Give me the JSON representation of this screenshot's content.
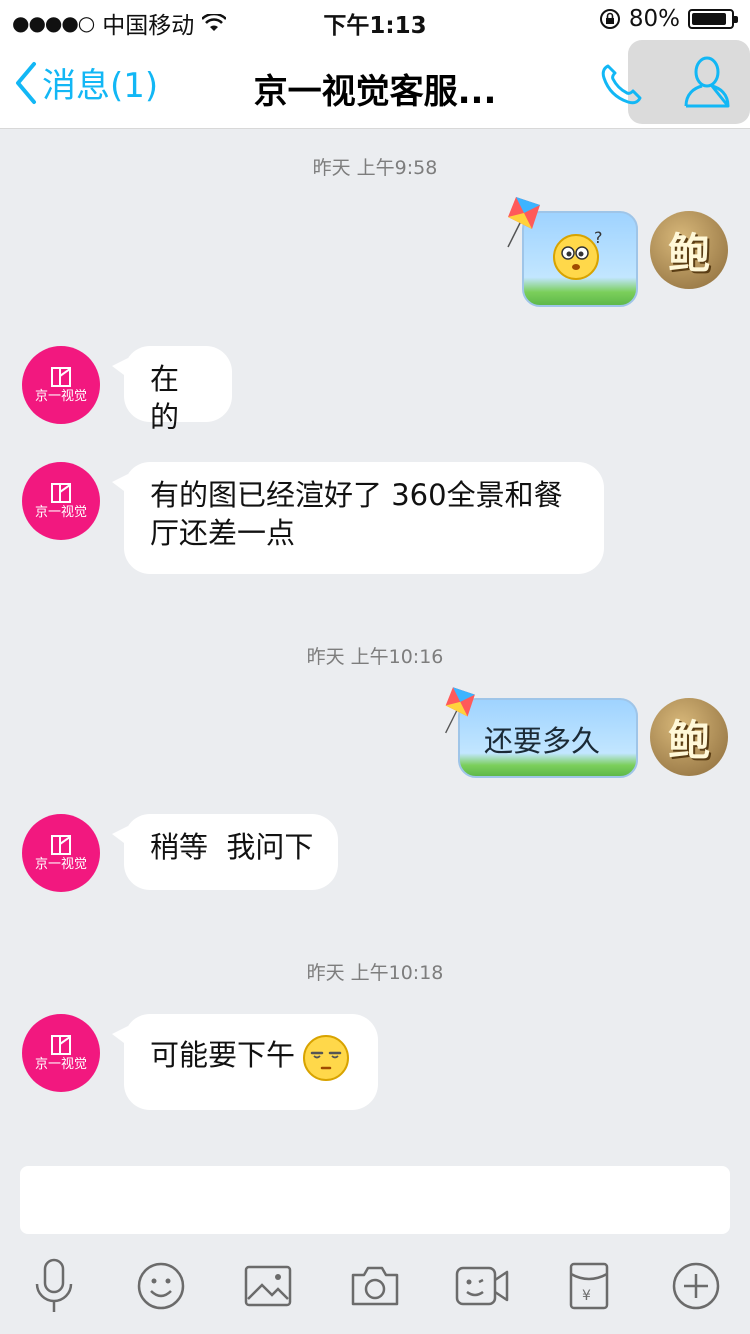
{
  "status_bar": {
    "signal_dots": "●●●●○",
    "carrier": "中国移动",
    "time": "下午1:13",
    "battery": "80%"
  },
  "nav": {
    "back_label": "消息(1)",
    "title": "京一视觉客服..."
  },
  "avatars": {
    "other_brand": "京一视觉",
    "self_glyph": "鲍"
  },
  "messages": {
    "ts1": "昨天 上午9:58",
    "m2": "在的",
    "m3_line1": "有的图已经渲好了  360全景和餐",
    "m3_line2": "厅还差一点",
    "ts2": "昨天 上午10:16",
    "m4": "还要多久",
    "m5": "稍等  我问下",
    "ts3": "昨天 上午10:18",
    "m6": "可能要下午"
  },
  "toolbar": {
    "items": [
      "mic-icon",
      "emoji-icon",
      "image-icon",
      "camera-icon",
      "video-icon",
      "red-packet-icon",
      "plus-icon"
    ]
  },
  "colors": {
    "accent": "#12b7f5",
    "brand_pink": "#f2187f",
    "chat_bg": "#ebedf0"
  }
}
